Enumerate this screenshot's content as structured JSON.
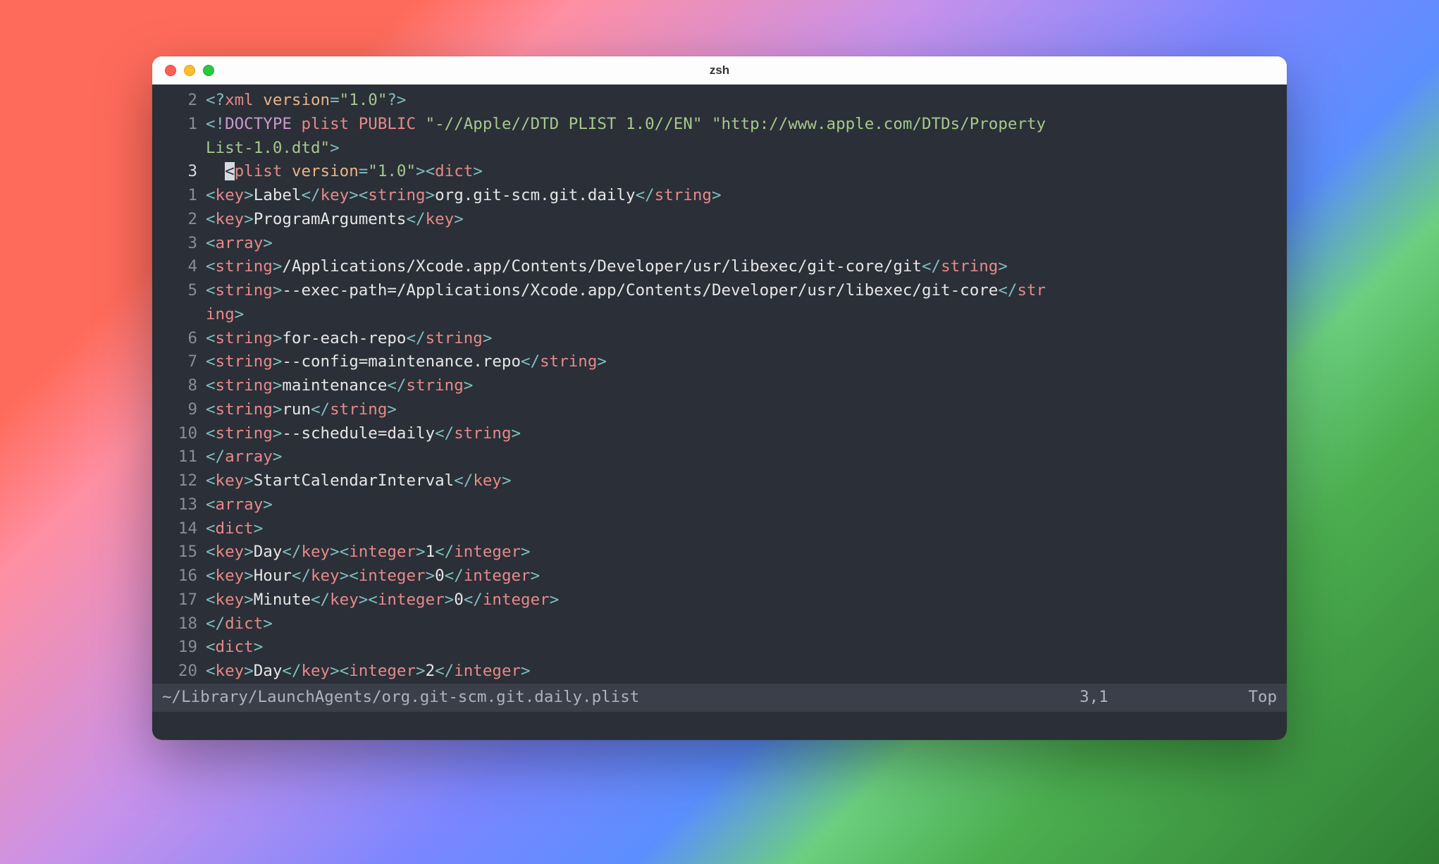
{
  "window": {
    "title": "zsh"
  },
  "editor": {
    "lines": [
      {
        "rel": "2",
        "current": false,
        "segments": [
          {
            "c": "ang",
            "t": "<?"
          },
          {
            "c": "tag",
            "t": "xml"
          },
          {
            "c": "text",
            "t": " "
          },
          {
            "c": "attr",
            "t": "version"
          },
          {
            "c": "ang",
            "t": "="
          },
          {
            "c": "str",
            "t": "\"1.0\""
          },
          {
            "c": "ang",
            "t": "?>"
          }
        ]
      },
      {
        "rel": "1",
        "current": false,
        "segments": [
          {
            "c": "ang",
            "t": "<!"
          },
          {
            "c": "doct",
            "t": "DOCTYPE"
          },
          {
            "c": "text",
            "t": " "
          },
          {
            "c": "tag",
            "t": "plist"
          },
          {
            "c": "text",
            "t": " "
          },
          {
            "c": "tag",
            "t": "PUBLIC"
          },
          {
            "c": "text",
            "t": " "
          },
          {
            "c": "str",
            "t": "\"-//Apple//DTD PLIST 1.0//EN\""
          },
          {
            "c": "text",
            "t": " "
          },
          {
            "c": "str",
            "t": "\"http://www.apple.com/DTDs/Property"
          }
        ]
      },
      {
        "rel": "",
        "current": false,
        "cont": true,
        "segments": [
          {
            "c": "str",
            "t": "List-1.0.dtd\""
          },
          {
            "c": "ang",
            "t": ">"
          }
        ]
      },
      {
        "rel": "3",
        "current": true,
        "segments": [
          {
            "c": "text",
            "t": "  "
          },
          {
            "c": "cursor",
            "t": "<"
          },
          {
            "c": "tag",
            "t": "plist"
          },
          {
            "c": "text",
            "t": " "
          },
          {
            "c": "attr",
            "t": "version"
          },
          {
            "c": "ang",
            "t": "="
          },
          {
            "c": "str",
            "t": "\"1.0\""
          },
          {
            "c": "ang",
            "t": "><"
          },
          {
            "c": "tag",
            "t": "dict"
          },
          {
            "c": "ang",
            "t": ">"
          }
        ]
      },
      {
        "rel": "1",
        "current": false,
        "segments": [
          {
            "c": "ang",
            "t": "<"
          },
          {
            "c": "tag",
            "t": "key"
          },
          {
            "c": "ang",
            "t": ">"
          },
          {
            "c": "text",
            "t": "Label"
          },
          {
            "c": "ang",
            "t": "</"
          },
          {
            "c": "tag",
            "t": "key"
          },
          {
            "c": "ang",
            "t": "><"
          },
          {
            "c": "tag",
            "t": "string"
          },
          {
            "c": "ang",
            "t": ">"
          },
          {
            "c": "text",
            "t": "org.git-scm.git.daily"
          },
          {
            "c": "ang",
            "t": "</"
          },
          {
            "c": "tag",
            "t": "string"
          },
          {
            "c": "ang",
            "t": ">"
          }
        ]
      },
      {
        "rel": "2",
        "current": false,
        "segments": [
          {
            "c": "ang",
            "t": "<"
          },
          {
            "c": "tag",
            "t": "key"
          },
          {
            "c": "ang",
            "t": ">"
          },
          {
            "c": "text",
            "t": "ProgramArguments"
          },
          {
            "c": "ang",
            "t": "</"
          },
          {
            "c": "tag",
            "t": "key"
          },
          {
            "c": "ang",
            "t": ">"
          }
        ]
      },
      {
        "rel": "3",
        "current": false,
        "segments": [
          {
            "c": "ang",
            "t": "<"
          },
          {
            "c": "tag",
            "t": "array"
          },
          {
            "c": "ang",
            "t": ">"
          }
        ]
      },
      {
        "rel": "4",
        "current": false,
        "segments": [
          {
            "c": "ang",
            "t": "<"
          },
          {
            "c": "tag",
            "t": "string"
          },
          {
            "c": "ang",
            "t": ">"
          },
          {
            "c": "text",
            "t": "/Applications/Xcode.app/Contents/Developer/usr/libexec/git-core/git"
          },
          {
            "c": "ang",
            "t": "</"
          },
          {
            "c": "tag",
            "t": "string"
          },
          {
            "c": "ang",
            "t": ">"
          }
        ]
      },
      {
        "rel": "5",
        "current": false,
        "segments": [
          {
            "c": "ang",
            "t": "<"
          },
          {
            "c": "tag",
            "t": "string"
          },
          {
            "c": "ang",
            "t": ">"
          },
          {
            "c": "text",
            "t": "--exec-path=/Applications/Xcode.app/Contents/Developer/usr/libexec/git-core"
          },
          {
            "c": "ang",
            "t": "</"
          },
          {
            "c": "tag",
            "t": "str"
          }
        ]
      },
      {
        "rel": "",
        "current": false,
        "cont": true,
        "segments": [
          {
            "c": "tag",
            "t": "ing"
          },
          {
            "c": "ang",
            "t": ">"
          }
        ]
      },
      {
        "rel": "6",
        "current": false,
        "segments": [
          {
            "c": "ang",
            "t": "<"
          },
          {
            "c": "tag",
            "t": "string"
          },
          {
            "c": "ang",
            "t": ">"
          },
          {
            "c": "text",
            "t": "for-each-repo"
          },
          {
            "c": "ang",
            "t": "</"
          },
          {
            "c": "tag",
            "t": "string"
          },
          {
            "c": "ang",
            "t": ">"
          }
        ]
      },
      {
        "rel": "7",
        "current": false,
        "segments": [
          {
            "c": "ang",
            "t": "<"
          },
          {
            "c": "tag",
            "t": "string"
          },
          {
            "c": "ang",
            "t": ">"
          },
          {
            "c": "text",
            "t": "--config=maintenance.repo"
          },
          {
            "c": "ang",
            "t": "</"
          },
          {
            "c": "tag",
            "t": "string"
          },
          {
            "c": "ang",
            "t": ">"
          }
        ]
      },
      {
        "rel": "8",
        "current": false,
        "segments": [
          {
            "c": "ang",
            "t": "<"
          },
          {
            "c": "tag",
            "t": "string"
          },
          {
            "c": "ang",
            "t": ">"
          },
          {
            "c": "text",
            "t": "maintenance"
          },
          {
            "c": "ang",
            "t": "</"
          },
          {
            "c": "tag",
            "t": "string"
          },
          {
            "c": "ang",
            "t": ">"
          }
        ]
      },
      {
        "rel": "9",
        "current": false,
        "segments": [
          {
            "c": "ang",
            "t": "<"
          },
          {
            "c": "tag",
            "t": "string"
          },
          {
            "c": "ang",
            "t": ">"
          },
          {
            "c": "text",
            "t": "run"
          },
          {
            "c": "ang",
            "t": "</"
          },
          {
            "c": "tag",
            "t": "string"
          },
          {
            "c": "ang",
            "t": ">"
          }
        ]
      },
      {
        "rel": "10",
        "current": false,
        "segments": [
          {
            "c": "ang",
            "t": "<"
          },
          {
            "c": "tag",
            "t": "string"
          },
          {
            "c": "ang",
            "t": ">"
          },
          {
            "c": "text",
            "t": "--schedule=daily"
          },
          {
            "c": "ang",
            "t": "</"
          },
          {
            "c": "tag",
            "t": "string"
          },
          {
            "c": "ang",
            "t": ">"
          }
        ]
      },
      {
        "rel": "11",
        "current": false,
        "segments": [
          {
            "c": "ang",
            "t": "</"
          },
          {
            "c": "tag",
            "t": "array"
          },
          {
            "c": "ang",
            "t": ">"
          }
        ]
      },
      {
        "rel": "12",
        "current": false,
        "segments": [
          {
            "c": "ang",
            "t": "<"
          },
          {
            "c": "tag",
            "t": "key"
          },
          {
            "c": "ang",
            "t": ">"
          },
          {
            "c": "text",
            "t": "StartCalendarInterval"
          },
          {
            "c": "ang",
            "t": "</"
          },
          {
            "c": "tag",
            "t": "key"
          },
          {
            "c": "ang",
            "t": ">"
          }
        ]
      },
      {
        "rel": "13",
        "current": false,
        "segments": [
          {
            "c": "ang",
            "t": "<"
          },
          {
            "c": "tag",
            "t": "array"
          },
          {
            "c": "ang",
            "t": ">"
          }
        ]
      },
      {
        "rel": "14",
        "current": false,
        "segments": [
          {
            "c": "ang",
            "t": "<"
          },
          {
            "c": "tag",
            "t": "dict"
          },
          {
            "c": "ang",
            "t": ">"
          }
        ]
      },
      {
        "rel": "15",
        "current": false,
        "segments": [
          {
            "c": "ang",
            "t": "<"
          },
          {
            "c": "tag",
            "t": "key"
          },
          {
            "c": "ang",
            "t": ">"
          },
          {
            "c": "text",
            "t": "Day"
          },
          {
            "c": "ang",
            "t": "</"
          },
          {
            "c": "tag",
            "t": "key"
          },
          {
            "c": "ang",
            "t": "><"
          },
          {
            "c": "tag",
            "t": "integer"
          },
          {
            "c": "ang",
            "t": ">"
          },
          {
            "c": "text",
            "t": "1"
          },
          {
            "c": "ang",
            "t": "</"
          },
          {
            "c": "tag",
            "t": "integer"
          },
          {
            "c": "ang",
            "t": ">"
          }
        ]
      },
      {
        "rel": "16",
        "current": false,
        "segments": [
          {
            "c": "ang",
            "t": "<"
          },
          {
            "c": "tag",
            "t": "key"
          },
          {
            "c": "ang",
            "t": ">"
          },
          {
            "c": "text",
            "t": "Hour"
          },
          {
            "c": "ang",
            "t": "</"
          },
          {
            "c": "tag",
            "t": "key"
          },
          {
            "c": "ang",
            "t": "><"
          },
          {
            "c": "tag",
            "t": "integer"
          },
          {
            "c": "ang",
            "t": ">"
          },
          {
            "c": "text",
            "t": "0"
          },
          {
            "c": "ang",
            "t": "</"
          },
          {
            "c": "tag",
            "t": "integer"
          },
          {
            "c": "ang",
            "t": ">"
          }
        ]
      },
      {
        "rel": "17",
        "current": false,
        "segments": [
          {
            "c": "ang",
            "t": "<"
          },
          {
            "c": "tag",
            "t": "key"
          },
          {
            "c": "ang",
            "t": ">"
          },
          {
            "c": "text",
            "t": "Minute"
          },
          {
            "c": "ang",
            "t": "</"
          },
          {
            "c": "tag",
            "t": "key"
          },
          {
            "c": "ang",
            "t": "><"
          },
          {
            "c": "tag",
            "t": "integer"
          },
          {
            "c": "ang",
            "t": ">"
          },
          {
            "c": "text",
            "t": "0"
          },
          {
            "c": "ang",
            "t": "</"
          },
          {
            "c": "tag",
            "t": "integer"
          },
          {
            "c": "ang",
            "t": ">"
          }
        ]
      },
      {
        "rel": "18",
        "current": false,
        "segments": [
          {
            "c": "ang",
            "t": "</"
          },
          {
            "c": "tag",
            "t": "dict"
          },
          {
            "c": "ang",
            "t": ">"
          }
        ]
      },
      {
        "rel": "19",
        "current": false,
        "segments": [
          {
            "c": "ang",
            "t": "<"
          },
          {
            "c": "tag",
            "t": "dict"
          },
          {
            "c": "ang",
            "t": ">"
          }
        ]
      },
      {
        "rel": "20",
        "current": false,
        "segments": [
          {
            "c": "ang",
            "t": "<"
          },
          {
            "c": "tag",
            "t": "key"
          },
          {
            "c": "ang",
            "t": ">"
          },
          {
            "c": "text",
            "t": "Day"
          },
          {
            "c": "ang",
            "t": "</"
          },
          {
            "c": "tag",
            "t": "key"
          },
          {
            "c": "ang",
            "t": "><"
          },
          {
            "c": "tag",
            "t": "integer"
          },
          {
            "c": "ang",
            "t": ">"
          },
          {
            "c": "text",
            "t": "2"
          },
          {
            "c": "ang",
            "t": "</"
          },
          {
            "c": "tag",
            "t": "integer"
          },
          {
            "c": "ang",
            "t": ">"
          }
        ]
      }
    ],
    "status": {
      "file": "~/Library/LaunchAgents/org.git-scm.git.daily.plist",
      "pos": "3,1",
      "scroll": "Top"
    }
  }
}
